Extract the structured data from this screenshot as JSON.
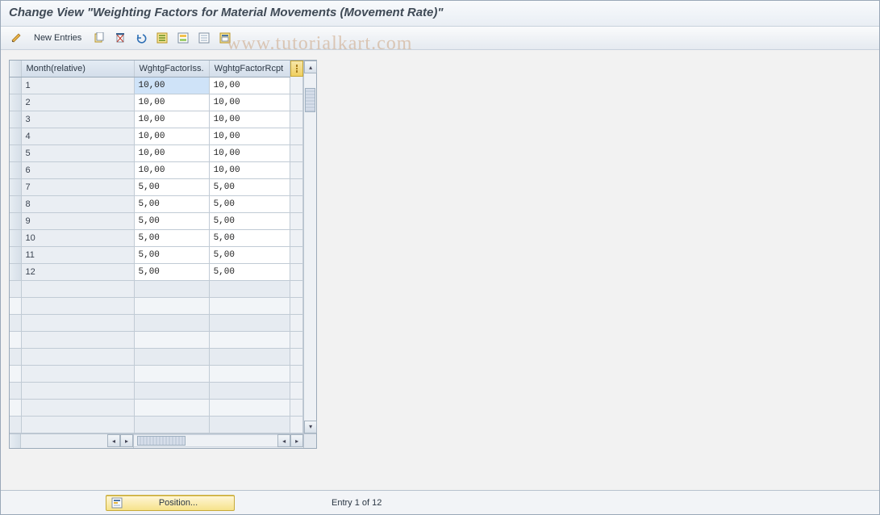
{
  "title": "Change View \"Weighting Factors for Material Movements (Movement Rate)\"",
  "watermark": "www.tutorialkart.com",
  "toolbar": {
    "new_entries": "New Entries"
  },
  "table": {
    "columns": {
      "month": "Month(relative)",
      "iss": "WghtgFactorIss.",
      "rcpt": "WghtgFactorRcpt"
    },
    "rows": [
      {
        "month": "1",
        "iss": "10,00",
        "rcpt": "10,00",
        "selected": true
      },
      {
        "month": "2",
        "iss": "10,00",
        "rcpt": "10,00"
      },
      {
        "month": "3",
        "iss": "10,00",
        "rcpt": "10,00"
      },
      {
        "month": "4",
        "iss": "10,00",
        "rcpt": "10,00"
      },
      {
        "month": "5",
        "iss": "10,00",
        "rcpt": "10,00"
      },
      {
        "month": "6",
        "iss": "10,00",
        "rcpt": "10,00"
      },
      {
        "month": "7",
        "iss": "5,00",
        "rcpt": "5,00"
      },
      {
        "month": "8",
        "iss": "5,00",
        "rcpt": "5,00"
      },
      {
        "month": "9",
        "iss": "5,00",
        "rcpt": "5,00"
      },
      {
        "month": "10",
        "iss": "5,00",
        "rcpt": "5,00"
      },
      {
        "month": "11",
        "iss": "5,00",
        "rcpt": "5,00"
      },
      {
        "month": "12",
        "iss": "5,00",
        "rcpt": "5,00"
      }
    ],
    "empty_rows": 9
  },
  "footer": {
    "position_label": "Position...",
    "entry_text": "Entry 1 of 12"
  }
}
